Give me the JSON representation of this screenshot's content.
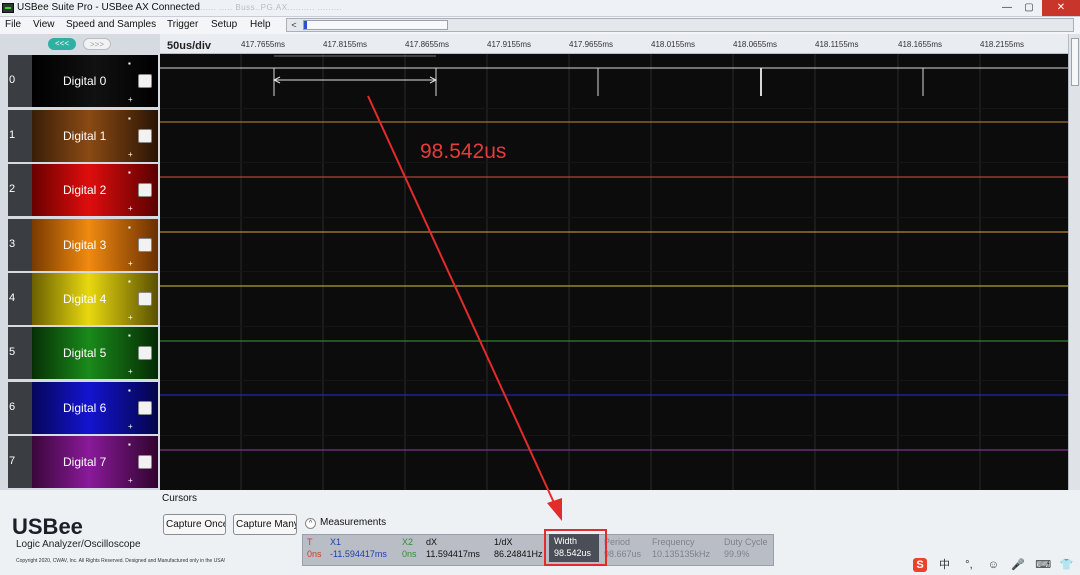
{
  "window": {
    "title": "USBee Suite Pro - USBee AX Connected",
    "ghost_text": "......  .....  Buss..PG.AX..........  .........",
    "buttons": {
      "minimize": "—",
      "maximize": "▢",
      "close": "✕"
    }
  },
  "menu": [
    "File",
    "View",
    "Speed and Samples",
    "Trigger",
    "Setup",
    "Help"
  ],
  "scrollbar": {
    "left_arrow": "<"
  },
  "nav_pills": {
    "left": "<<<",
    "right": ">>>"
  },
  "timebase": "50us/div",
  "time_ticks": [
    "417.7655ms",
    "417.8155ms",
    "417.8655ms",
    "417.9155ms",
    "417.9655ms",
    "418.0155ms",
    "418.0655ms",
    "418.1155ms",
    "418.1655ms",
    "418.2155ms"
  ],
  "channels": [
    {
      "number": "0",
      "label": "Digital 0",
      "color": "#000000",
      "trace": "#d8d8d8"
    },
    {
      "number": "1",
      "label": "Digital 1",
      "color": "#8a4a14",
      "trace": "#c98a2c"
    },
    {
      "number": "2",
      "label": "Digital 2",
      "color": "#e00d0d",
      "trace": "#e34a4a"
    },
    {
      "number": "3",
      "label": "Digital 3",
      "color": "#f08a10",
      "trace": "#e0a43a"
    },
    {
      "number": "4",
      "label": "Digital 4",
      "color": "#e8d810",
      "trace": "#d9c23c"
    },
    {
      "number": "5",
      "label": "Digital 5",
      "color": "#1a8a1a",
      "trace": "#2fa02f"
    },
    {
      "number": "6",
      "label": "Digital 6",
      "color": "#1414d0",
      "trace": "#2b2bd0"
    },
    {
      "number": "7",
      "label": "Digital 7",
      "color": "#8a1a9a",
      "trace": "#9a3aa8"
    }
  ],
  "annotation": "98.542us",
  "cursors_label": "Cursors",
  "brand": {
    "logo": "USBee",
    "tagline": "Logic Analyzer/Oscilloscope",
    "copyright": "Copyright 2020, CWAV, Inc. All Rights Reserved. Designed and Manufactured only in the USA!"
  },
  "buttons": {
    "capture_once": "Capture Once",
    "capture_many": "Capture Many"
  },
  "measurements": {
    "title": "Measurements",
    "toggle": "^",
    "columns": [
      {
        "header": "T",
        "value": "0ns"
      },
      {
        "header": "X1",
        "value": "-11.594417ms"
      },
      {
        "header": "X2",
        "value": "0ns"
      },
      {
        "header": "dX",
        "value": "11.594417ms"
      },
      {
        "header": "1/dX",
        "value": "86.24841Hz"
      },
      {
        "header": "Width",
        "value": "98.542us"
      },
      {
        "header": "Period",
        "value": "98.667us"
      },
      {
        "header": "Frequency",
        "value": "10.135135kHz"
      },
      {
        "header": "Duty Cycle",
        "value": "99.9%"
      }
    ]
  },
  "tray": {
    "ime": "S",
    "icons": [
      "中",
      "°,",
      "☺",
      "🎤",
      "⌨",
      "👕",
      "☰"
    ]
  },
  "colors": {
    "accent_red": "#e42b2b",
    "scope_bg": "#0c0c0c",
    "pill_teal": "#2fb0a2"
  }
}
